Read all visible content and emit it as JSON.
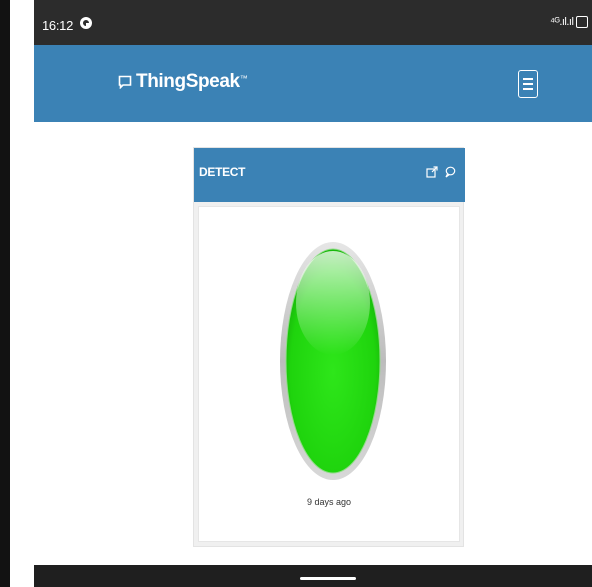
{
  "status_bar": {
    "time": "16:12",
    "right_text": "⁴ᴳ.ıl.ıl",
    "app_icon": "whatsapp-icon"
  },
  "navbar": {
    "brand": "ThingSpeak",
    "trademark": "™",
    "brand_icon": "speech-bubble-icon",
    "menu_icon": "hamburger-menu-icon",
    "color": "#3b82b5"
  },
  "widget": {
    "title": "DETECT",
    "icons": [
      "external-link-icon",
      "comment-icon"
    ],
    "lamp_state": "on",
    "lamp_color": "#22e012",
    "caption": "9 days ago"
  }
}
